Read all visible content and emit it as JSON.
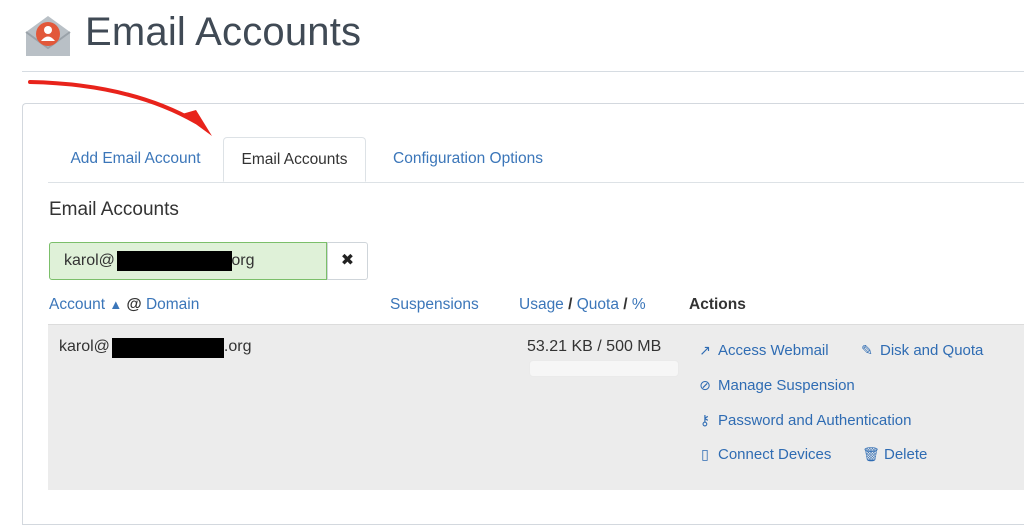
{
  "page": {
    "title": "Email Accounts",
    "icon": "envelope-user-icon"
  },
  "tabs": [
    {
      "label": "Add Email Account",
      "active": false
    },
    {
      "label": "Email Accounts",
      "active": true
    },
    {
      "label": "Configuration Options",
      "active": false
    }
  ],
  "section": {
    "title": "Email Accounts"
  },
  "search": {
    "value_prefix": "karol@",
    "value_suffix": ".org",
    "clear_icon": "times-icon",
    "clear_label": "✖"
  },
  "table": {
    "headers": {
      "account": "Account",
      "sort_indicator": "▲",
      "at": "@",
      "domain": "Domain",
      "suspensions": "Suspensions",
      "usage": "Usage",
      "sep1": "/",
      "quota": "Quota",
      "sep2": "/",
      "percent": "%",
      "actions": "Actions"
    },
    "rows": [
      {
        "email_prefix": "karol@",
        "email_suffix": ".org",
        "usage": "53.21 KB / 500 MB",
        "usage_fraction": 0.0001,
        "actions": [
          {
            "label": "Access Webmail",
            "icon": "external-link-icon"
          },
          {
            "label": "Disk and Quota",
            "icon": "pencil-icon"
          },
          {
            "label": "Manage Suspension",
            "icon": "ban-icon"
          },
          {
            "label": "Password and Authentication",
            "icon": "key-icon"
          },
          {
            "label": "Connect Devices",
            "icon": "mobile-icon"
          },
          {
            "label": "Delete",
            "icon": "trash-icon"
          }
        ]
      }
    ]
  },
  "colors": {
    "link": "#3b76b9",
    "search_bg": "#dff1d8",
    "search_border": "#7bbf6a",
    "row_bg": "#ececec",
    "annotation_arrow": "#e8231b"
  }
}
